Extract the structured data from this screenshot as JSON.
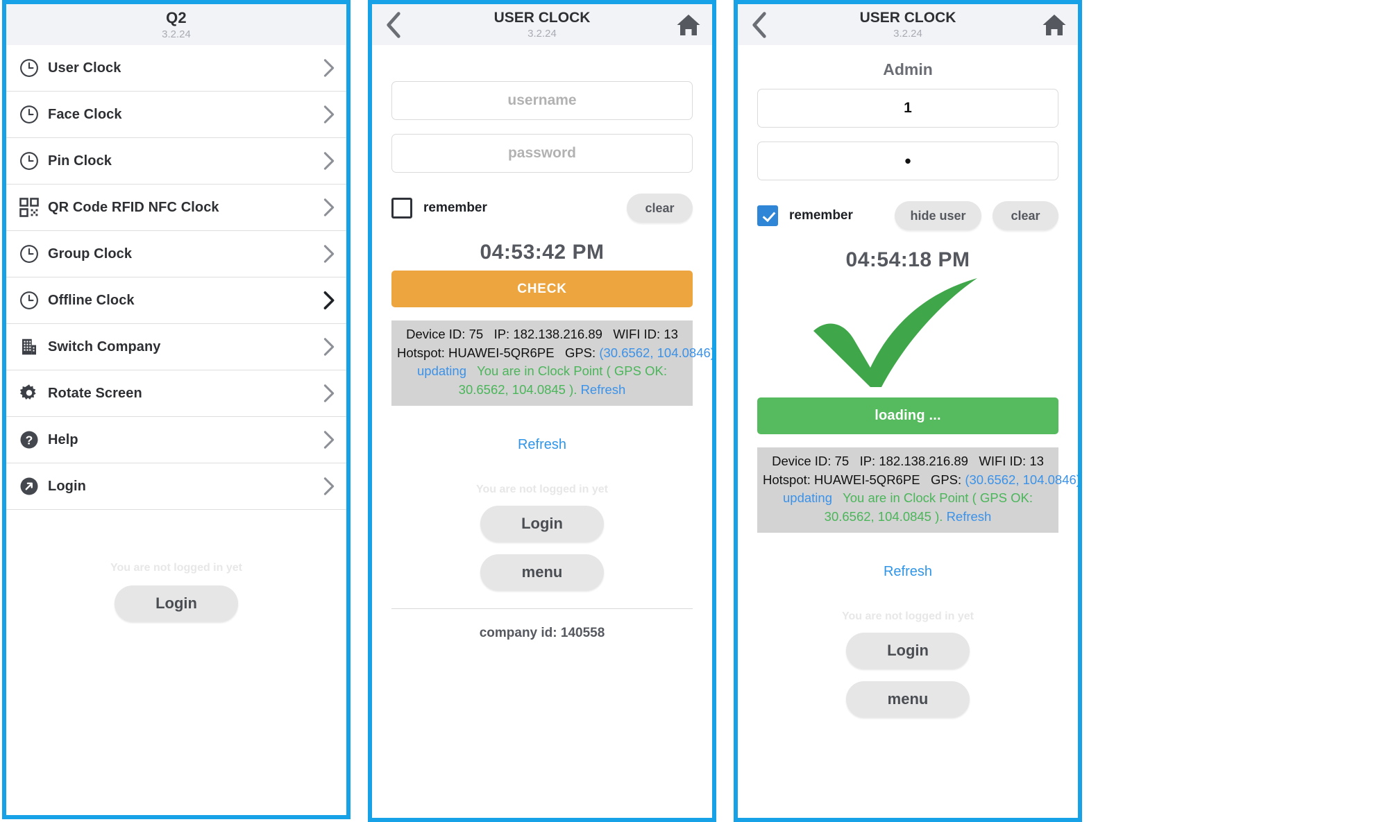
{
  "colors": {
    "frame": "#17a2e8",
    "header_bg": "#f2f3f7",
    "check_button": "#eda53f",
    "loading_button": "#56bb5f",
    "link": "#2f95e8",
    "gps_ok_green": "#4bb55a",
    "info_bg": "#d3d3d3",
    "checkbox_on": "#2f86d6"
  },
  "panel1": {
    "header": {
      "title": "Q2",
      "version": "3.2.24"
    },
    "menu": [
      {
        "label": "User Clock",
        "icon": "clock-icon",
        "chevron": "chevron-right-icon"
      },
      {
        "label": "Face Clock",
        "icon": "clock-icon",
        "chevron": "chevron-right-icon"
      },
      {
        "label": "Pin Clock",
        "icon": "clock-icon",
        "chevron": "chevron-right-icon"
      },
      {
        "label": "QR Code RFID NFC Clock",
        "icon": "qr-code-icon",
        "chevron": "chevron-right-icon"
      },
      {
        "label": "Group Clock",
        "icon": "clock-icon",
        "chevron": "chevron-right-icon"
      },
      {
        "label": "Offline Clock",
        "icon": "clock-icon",
        "chevron": "chevron-right-icon"
      },
      {
        "label": "Switch Company",
        "icon": "building-icon",
        "chevron": "chevron-right-icon"
      },
      {
        "label": "Rotate Screen",
        "icon": "gear-icon",
        "chevron": "chevron-right-icon"
      },
      {
        "label": "Help",
        "icon": "question-circle-icon",
        "chevron": "chevron-right-icon"
      },
      {
        "label": "Login",
        "icon": "arrow-circle-icon",
        "chevron": "chevron-right-icon"
      }
    ],
    "footer": {
      "not_logged_in": "You are not logged in yet",
      "login_label": "Login"
    }
  },
  "panel2": {
    "header": {
      "title": "USER CLOCK",
      "version": "3.2.24",
      "back": "back-icon",
      "home": "home-icon"
    },
    "form": {
      "username_placeholder": "username",
      "username_value": "",
      "password_placeholder": "password",
      "password_value": "",
      "remember_label": "remember",
      "remember_checked": false,
      "clear_label": "clear"
    },
    "clock": "04:53:42 PM",
    "action_label": "CHECK",
    "info": {
      "device_id_label": "Device ID:",
      "device_id": "75",
      "ip_label": "IP:",
      "ip": "182.138.216.89",
      "wifi_id_label": "WIFI ID:",
      "wifi_id": "13",
      "hotspot_label": "Hotspot:",
      "hotspot": "HUAWEI-5QR6PE",
      "gps_label": "GPS:",
      "gps": "(30.6562, 104.0846)",
      "updating": "updating",
      "status": "You are in Clock Point ( GPS OK: 30.6562, 104.0845 ).",
      "refresh": "Refresh"
    },
    "refresh_link": "Refresh",
    "footer": {
      "not_logged_in": "You are not logged in yet",
      "login_label": "Login",
      "menu_label": "menu",
      "company": "company id: 140558"
    }
  },
  "panel3": {
    "header": {
      "title": "USER CLOCK",
      "version": "3.2.24",
      "back": "back-icon",
      "home": "home-icon"
    },
    "user_title": "Admin",
    "form": {
      "username_value": "1",
      "password_value": "•",
      "remember_label": "remember",
      "remember_checked": true,
      "hide_user_label": "hide user",
      "clear_label": "clear"
    },
    "clock": "04:54:18 PM",
    "success_icon": "green-check-icon",
    "action_label": "loading ...",
    "info": {
      "device_id_label": "Device ID:",
      "device_id": "75",
      "ip_label": "IP:",
      "ip": "182.138.216.89",
      "wifi_id_label": "WIFI ID:",
      "wifi_id": "13",
      "hotspot_label": "Hotspot:",
      "hotspot": "HUAWEI-5QR6PE",
      "gps_label": "GPS:",
      "gps": "(30.6562, 104.0846)",
      "updating": "updating",
      "status": "You are in Clock Point ( GPS OK: 30.6562, 104.0845 ).",
      "refresh": "Refresh"
    },
    "refresh_link": "Refresh",
    "footer": {
      "not_logged_in": "You are not logged in yet",
      "login_label": "Login",
      "menu_label": "menu"
    }
  }
}
